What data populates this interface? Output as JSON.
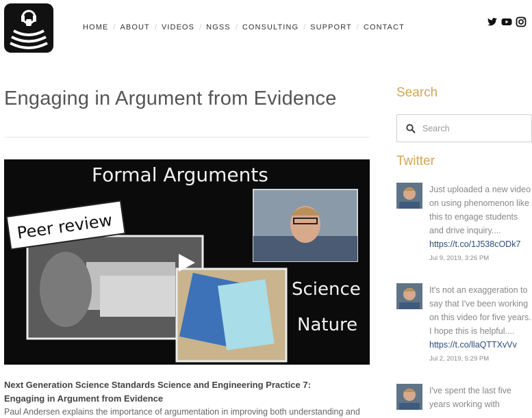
{
  "nav": [
    "HOME",
    "ABOUT",
    "VIDEOS",
    "NGSS",
    "CONSULTING",
    "SUPPORT",
    "CONTACT"
  ],
  "social": [
    "twitter-icon",
    "youtube-icon",
    "instagram-icon"
  ],
  "page_title": "Engaging in Argument from Evidence",
  "video": {
    "heading": "Formal Arguments",
    "peer_label": "Peer review",
    "science_label": "Science",
    "nature_label": "Nature"
  },
  "description": {
    "heading_line1": "Next Generation Science Standards Science and Engineering Practice 7:",
    "heading_line2": "Engaging in Argument from Evidence",
    "body": "Paul Andersen explains the importance of argumentation in improving both understanding and"
  },
  "sidebar": {
    "search_title": "Search",
    "search_placeholder": "Search",
    "twitter_title": "Twitter",
    "tweets": [
      {
        "lines": [
          "Just uploaded a new video",
          "on using phenomenon like",
          "this to engage students",
          "and drive inquiry...."
        ],
        "link": "https://t.co/1J538cODk7",
        "date": "Jul 9, 2019, 3:26 PM"
      },
      {
        "lines": [
          "It's not an exaggeration to",
          "say that I've been working",
          "on this video for five years.",
          "I hope this is helpful...."
        ],
        "link": "https://t.co/llaQTTXvVv",
        "date": "Jul 2, 2019, 5:29 PM"
      },
      {
        "lines": [
          "I've spent the last five",
          "years working with"
        ],
        "link": "",
        "date": ""
      }
    ]
  },
  "colors": {
    "accent": "#d4a651",
    "link": "#2b4c7e",
    "video_bg": "#0b0b0b"
  }
}
